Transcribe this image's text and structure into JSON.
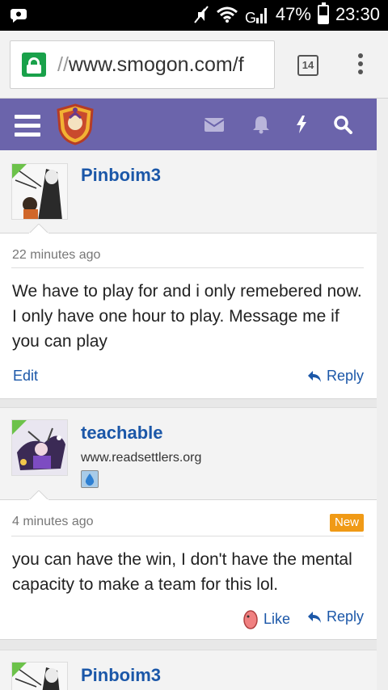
{
  "status_bar": {
    "battery": "47%",
    "time": "23:30",
    "battery_level": 0.47,
    "icons": [
      "notification-icon",
      "mute-icon",
      "wifi-icon",
      "signal-icon",
      "battery-icon"
    ]
  },
  "browser": {
    "url_prefix": "//",
    "url_text": "www.smogon.com/f",
    "tab_count": "14",
    "secure": true
  },
  "site_header": {
    "icons": [
      "menu-icon",
      "logo",
      "envelope-icon",
      "bell-icon",
      "lightning-icon",
      "search-icon"
    ],
    "background": "#6b64ab"
  },
  "posts": [
    {
      "username": "Pinboim3",
      "timestamp": "22 minutes ago",
      "message": "We have to play for and i only remebered now. I only have one hour to play. Message me if you can play",
      "actions": {
        "edit": "Edit",
        "reply": "Reply"
      }
    },
    {
      "username": "teachable",
      "user_title": "www.readsettlers.org",
      "timestamp": "4 minutes ago",
      "new_label": "New",
      "message": "you can have the win, I don't have the mental capacity to make a team for this lol.",
      "actions": {
        "like": "Like",
        "reply": "Reply"
      }
    },
    {
      "username": "Pinboim3"
    }
  ],
  "colors": {
    "link": "#1b57a8",
    "new_badge": "#f09a16",
    "online_indicator": "#6cc24a",
    "secure_lock": "#19a14a"
  }
}
